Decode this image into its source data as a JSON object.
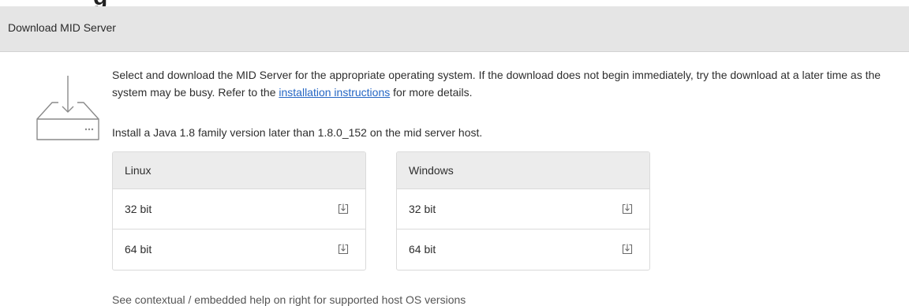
{
  "page": {
    "cutoff_title": "g",
    "title": "Download MID Server"
  },
  "intro": {
    "text_before": "Select and download the MID Server for the appropriate operating system. If the download does not begin immediately, try the download at a later time as the system may be busy. Refer to the ",
    "link_label": "installation instructions",
    "text_after": " for more details."
  },
  "java_note": "Install a Java 1.8 family version later than 1.8.0_152 on the mid server host.",
  "downloads": {
    "linux": {
      "title": "Linux",
      "rows": [
        {
          "label": "32 bit",
          "icon": "download-icon"
        },
        {
          "label": "64 bit",
          "icon": "download-icon"
        }
      ]
    },
    "windows": {
      "title": "Windows",
      "rows": [
        {
          "label": "32 bit",
          "icon": "download-icon"
        },
        {
          "label": "64 bit",
          "icon": "download-icon"
        }
      ]
    }
  },
  "footnote": "See contextual / embedded help on right for supported host OS versions",
  "colors": {
    "header_bg": "#e5e5e5",
    "link": "#2466c4",
    "table_header_bg": "#ececec",
    "border": "#dadada"
  }
}
